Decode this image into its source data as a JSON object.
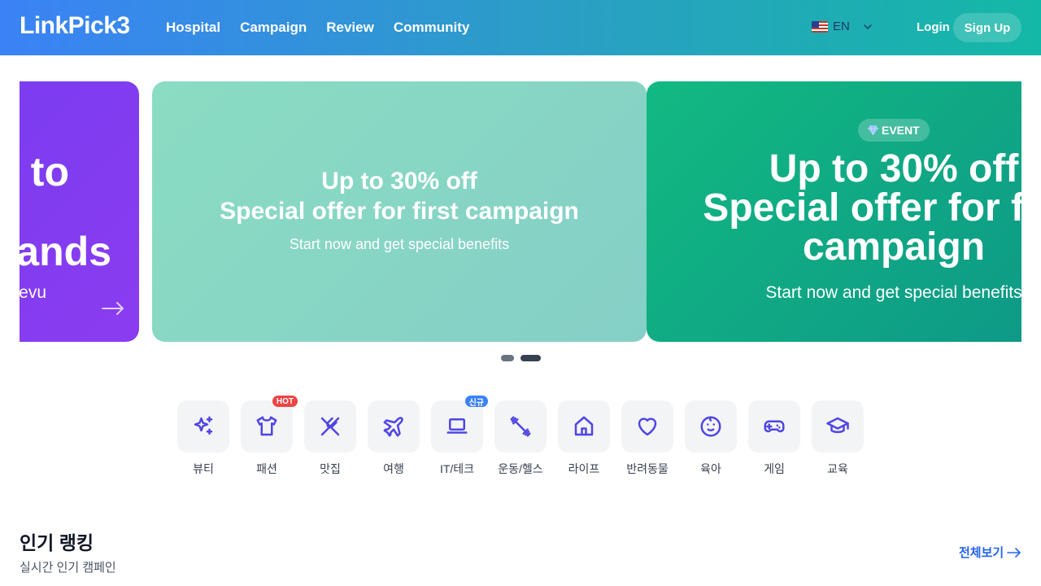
{
  "header": {
    "logo": "LinkPick3",
    "nav": [
      "Hospital",
      "Campaign",
      "Review",
      "Community"
    ],
    "language": "EN",
    "login_label": "Login",
    "signup_label": "Sign Up"
  },
  "carousel": {
    "slide_prev": {
      "line1": "y to",
      "line2": "ands",
      "sub": "evu"
    },
    "slide_current": {
      "title_line1": "Up to 30% off",
      "title_line2": "Special offer for first campaign",
      "sub": "Start now and get special benefits"
    },
    "slide_next": {
      "badge": "EVENT",
      "title_line1": "Up to 30% off",
      "title_line2": "Special offer for first",
      "title_line3": "campaign",
      "sub": "Start now and get special benefits"
    },
    "dots": 2,
    "active_dot": 1
  },
  "categories": [
    {
      "label": "뷰티",
      "icon": "sparkles-icon"
    },
    {
      "label": "패션",
      "icon": "shirt-icon",
      "tag": "HOT"
    },
    {
      "label": "맛집",
      "icon": "utensils-icon"
    },
    {
      "label": "여행",
      "icon": "plane-icon"
    },
    {
      "label": "IT/테크",
      "icon": "laptop-icon",
      "tag": "신규"
    },
    {
      "label": "운동/헬스",
      "icon": "dumbbell-icon"
    },
    {
      "label": "라이프",
      "icon": "home-icon"
    },
    {
      "label": "반려동물",
      "icon": "heart-icon"
    },
    {
      "label": "육아",
      "icon": "baby-icon"
    },
    {
      "label": "게임",
      "icon": "gamepad-icon"
    },
    {
      "label": "교육",
      "icon": "graduation-cap-icon"
    }
  ],
  "ranking": {
    "title": "인기 랭킹",
    "subtitle": "실시간 인기 캠페인",
    "see_all": "전체보기"
  },
  "colors": {
    "header_start": "#3b82f6",
    "header_end": "#14b8a6",
    "icon_accent": "#4f46e5",
    "link": "#2563eb"
  }
}
